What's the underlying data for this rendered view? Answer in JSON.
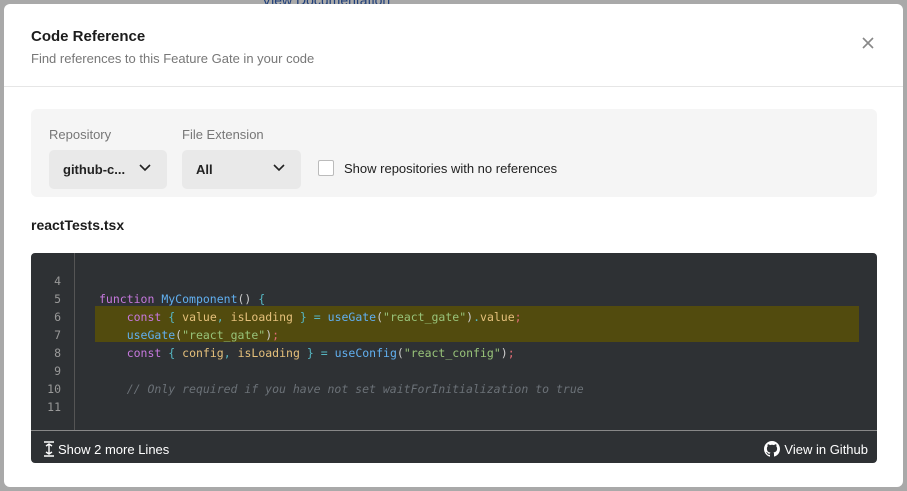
{
  "background": {
    "link": "View Documentation"
  },
  "modal": {
    "title": "Code Reference",
    "subtitle": "Find references to this Feature Gate in your code"
  },
  "filters": {
    "repository_label": "Repository",
    "repository_value": "github-c...",
    "extension_label": "File Extension",
    "extension_value": "All",
    "show_empty_label": "Show repositories with no references",
    "show_empty_checked": false
  },
  "file": {
    "name": "reactTests.tsx"
  },
  "code": {
    "highlight_color": "#524b0e",
    "lines": [
      {
        "n": "4",
        "t": ""
      },
      {
        "n": "5",
        "t": "function MyComponent() {"
      },
      {
        "n": "6",
        "t": "    const { value, isLoading } = useGate(\"react_gate\").value;"
      },
      {
        "n": "7",
        "t": "    useGate(\"react_gate\");"
      },
      {
        "n": "8",
        "t": "    const { config, isLoading } = useConfig(\"react_config\");"
      },
      {
        "n": "9",
        "t": ""
      },
      {
        "n": "10",
        "t": "    // Only required if you have not set waitForInitialization to true"
      },
      {
        "n": "11",
        "t": ""
      }
    ]
  },
  "footer": {
    "show_more": "Show 2 more Lines",
    "github": "View in Github"
  }
}
